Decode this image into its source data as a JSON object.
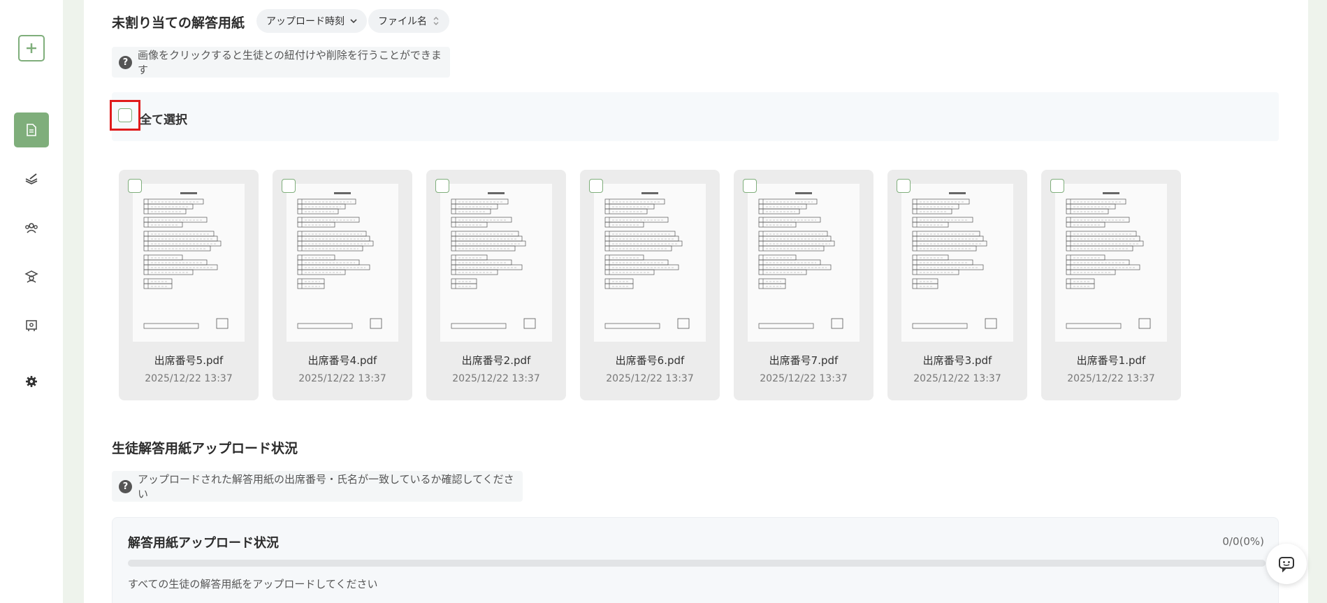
{
  "unassigned": {
    "title": "未割り当ての解答用紙",
    "sort_upload_label": "アップロード時刻",
    "sort_filename_label": "ファイル名",
    "hint": "画像をクリックすると生徒との紐付けや削除を行うことができます",
    "select_all_label": "全て選択",
    "files": [
      {
        "name": "出席番号5.pdf",
        "date": "2025/12/22 13:37"
      },
      {
        "name": "出席番号4.pdf",
        "date": "2025/12/22 13:37"
      },
      {
        "name": "出席番号2.pdf",
        "date": "2025/12/22 13:37"
      },
      {
        "name": "出席番号6.pdf",
        "date": "2025/12/22 13:37"
      },
      {
        "name": "出席番号7.pdf",
        "date": "2025/12/22 13:37"
      },
      {
        "name": "出席番号3.pdf",
        "date": "2025/12/22 13:37"
      },
      {
        "name": "出席番号1.pdf",
        "date": "2025/12/22 13:37"
      }
    ]
  },
  "upload_status": {
    "section_title": "生徒解答用紙アップロード状況",
    "hint": "アップロードされた解答用紙の出席番号・氏名が一致しているか確認してください",
    "box_title": "解答用紙アップロード状況",
    "count": "0/0(0%)",
    "progress": 0,
    "message": "すべての生徒の解答用紙をアップロードしてください"
  },
  "sidebar": {
    "icons": [
      "add-icon",
      "document-icon",
      "book-pen-icon",
      "students-icon",
      "teacher-icon",
      "classroom-icon",
      "gear-icon"
    ]
  },
  "colors": {
    "accent": "#7fae7b",
    "highlight": "#e01b1b",
    "card_bg": "#ececec"
  }
}
